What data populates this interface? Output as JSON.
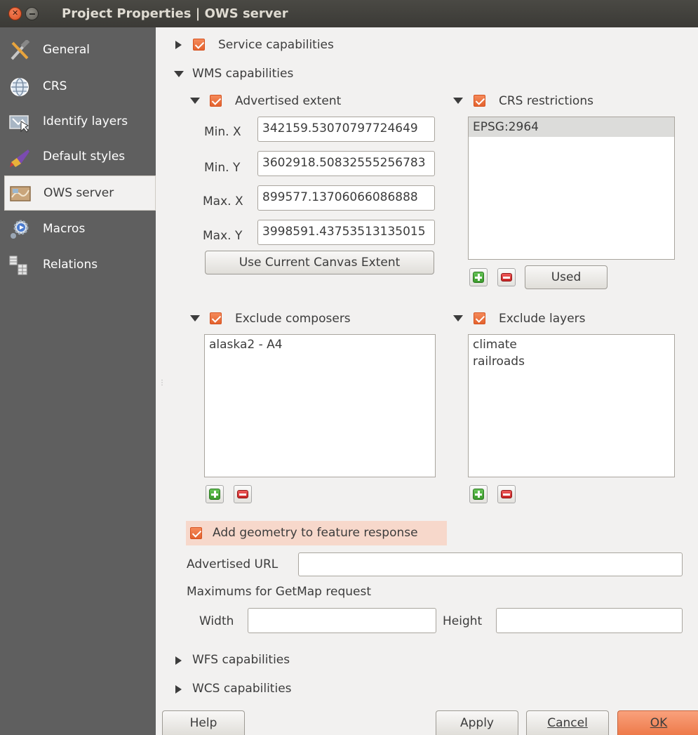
{
  "window": {
    "title": "Project Properties | OWS server"
  },
  "sidebar": {
    "items": [
      {
        "label": "General",
        "icon": "hammer-wrench-icon"
      },
      {
        "label": "CRS",
        "icon": "globe-icon"
      },
      {
        "label": "Identify layers",
        "icon": "identify-icon"
      },
      {
        "label": "Default styles",
        "icon": "paintbrush-icon"
      },
      {
        "label": "OWS server",
        "icon": "map-icon",
        "selected": true
      },
      {
        "label": "Macros",
        "icon": "gear-icon"
      },
      {
        "label": "Relations",
        "icon": "table-icon"
      }
    ]
  },
  "service": {
    "label": "Service capabilities",
    "checked": true,
    "expanded": false
  },
  "wms": {
    "label": "WMS capabilities",
    "extent": {
      "label": "Advertised extent",
      "checked": true,
      "minx_label": "Min. X",
      "minx": "342159.53070797724649",
      "miny_label": "Min. Y",
      "miny": "3602918.50832555256783",
      "maxx_label": "Max. X",
      "maxx": "899577.13706066086888",
      "maxy_label": "Max. Y",
      "maxy": "3998591.43753513135015",
      "canvas_button": "Use Current Canvas Extent"
    },
    "crs": {
      "label": "CRS restrictions",
      "checked": true,
      "items": [
        "EPSG:2964"
      ],
      "used_button": "Used"
    },
    "composers": {
      "label": "Exclude composers",
      "checked": true,
      "items": [
        "alaska2 - A4"
      ]
    },
    "layers": {
      "label": "Exclude layers",
      "checked": true,
      "items": [
        "climate",
        "railroads"
      ]
    },
    "geometry": {
      "label": "Add geometry to feature response",
      "checked": true
    },
    "url": {
      "label": "Advertised URL",
      "value": ""
    },
    "getmap": {
      "label": "Maximums for GetMap request",
      "width_label": "Width",
      "width": "",
      "height_label": "Height",
      "height": ""
    }
  },
  "wfs": {
    "label": "WFS capabilities"
  },
  "wcs": {
    "label": "WCS capabilities"
  },
  "buttons": {
    "help": "Help",
    "apply": "Apply",
    "cancel": "Cancel",
    "ok": "OK"
  },
  "colors": {
    "accent": "#e3622e",
    "sidebar": "#5f5f5f",
    "window": "#f2f1f0"
  }
}
